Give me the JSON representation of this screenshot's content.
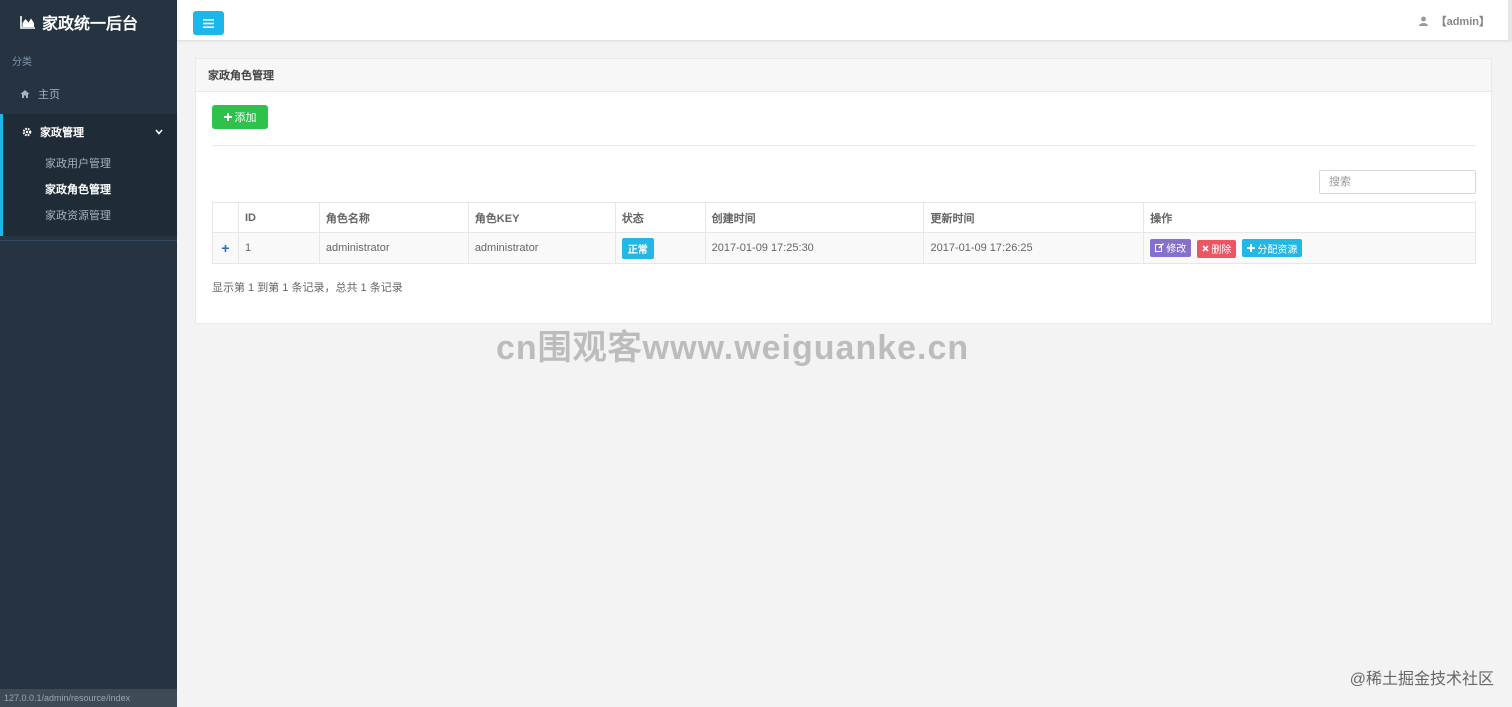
{
  "sidebar": {
    "brand": "家政统一后台",
    "brand_icon": "area-chart-icon",
    "section_label": "分类",
    "home_label": "主页",
    "group_label": "家政管理",
    "group_items": [
      {
        "label": "家政用户管理",
        "active": false
      },
      {
        "label": "家政角色管理",
        "active": true
      },
      {
        "label": "家政资源管理",
        "active": false
      }
    ],
    "status_url": "127.0.0.1/admin/resource/index"
  },
  "topbar": {
    "user_label": "【admin】"
  },
  "panel": {
    "title": "家政角色管理",
    "add_label": "添加",
    "search_placeholder": "搜索",
    "columns": [
      "",
      "ID",
      "角色名称",
      "角色KEY",
      "状态",
      "创建时间",
      "更新时间",
      "操作"
    ],
    "rows": [
      {
        "expand": "+",
        "id": "1",
        "name": "administrator",
        "key": "administrator",
        "status": "正常",
        "created": "2017-01-09 17:25:30",
        "updated": "2017-01-09 17:26:25",
        "ops": {
          "edit": "修改",
          "delete": "删除",
          "assign": "分配资源"
        }
      }
    ],
    "summary": "显示第 1 到第 1 条记录，总共 1 条记录"
  },
  "watermark": "cn围观客www.weiguanke.cn",
  "corner_mark": "@稀土掘金技术社区",
  "colors": {
    "sidebar_bg": "#263442",
    "accent": "#1ab7ea",
    "add_green": "#2ec14b",
    "edit_purple": "#8571c9",
    "delete_red": "#ed5565",
    "status_blue": "#23b7e5"
  }
}
